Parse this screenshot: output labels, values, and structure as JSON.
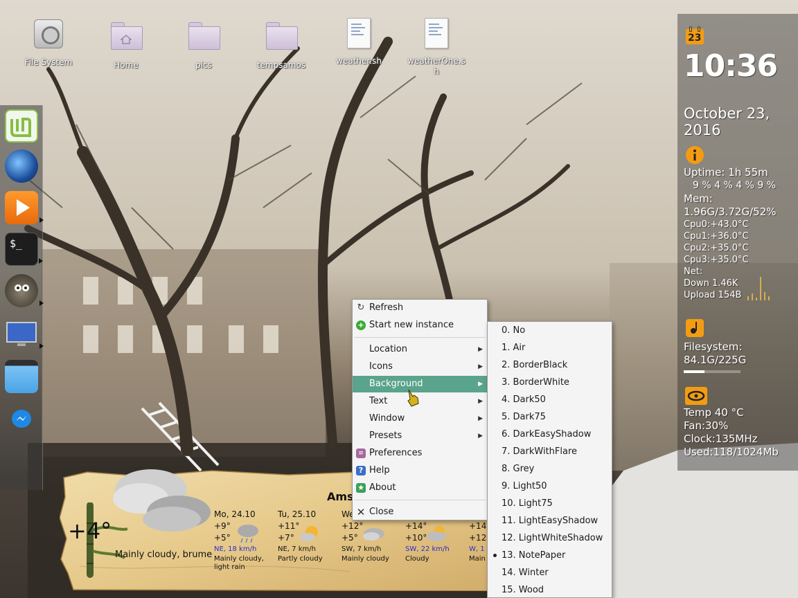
{
  "desktop": {
    "icons": [
      {
        "label": "File System",
        "icon": "drive-icon"
      },
      {
        "label": "Home",
        "icon": "home-folder-icon"
      },
      {
        "label": "pics",
        "icon": "folder-icon"
      },
      {
        "label": "tempsamos",
        "icon": "folder-icon"
      },
      {
        "label": "weather.sh",
        "icon": "script-file-icon"
      },
      {
        "label": "weatherOne.sh",
        "icon": "script-file-icon"
      }
    ]
  },
  "dock": {
    "items": [
      {
        "name": "linux-mint-menu",
        "icon": "mint-logo-icon"
      },
      {
        "name": "thunderbird",
        "icon": "thunderbird-icon"
      },
      {
        "name": "media-player",
        "icon": "play-icon"
      },
      {
        "name": "terminal",
        "icon": "terminal-icon",
        "text": "$_"
      },
      {
        "name": "gimp",
        "icon": "gimp-icon"
      },
      {
        "name": "display",
        "icon": "monitor-icon"
      },
      {
        "name": "files",
        "icon": "folder-blue-icon"
      },
      {
        "name": "messenger",
        "icon": "messenger-icon"
      }
    ]
  },
  "context_menu": {
    "items": [
      {
        "label": "Refresh",
        "icon": "refresh-icon",
        "submenu": false
      },
      {
        "label": "Start new instance",
        "icon": "plus-circle-icon",
        "submenu": false
      },
      {
        "label": "Location",
        "submenu": true
      },
      {
        "label": "Icons",
        "submenu": true
      },
      {
        "label": "Background",
        "submenu": true,
        "highlighted": true
      },
      {
        "label": "Text",
        "submenu": true
      },
      {
        "label": "Window",
        "submenu": true
      },
      {
        "label": "Presets",
        "submenu": true
      },
      {
        "label": "Preferences",
        "icon": "preferences-icon",
        "submenu": false
      },
      {
        "label": "Help",
        "icon": "help-icon",
        "submenu": false
      },
      {
        "label": "About",
        "icon": "about-icon",
        "submenu": false
      },
      {
        "label": "Close",
        "icon": "close-icon",
        "submenu": false
      }
    ],
    "submenu_arrow": "▶"
  },
  "background_submenu": {
    "selected": "13. NotePaper",
    "items": [
      "0. No",
      "1. Air",
      "2. BorderBlack",
      "3. BorderWhite",
      "4. Dark50",
      "5. Dark75",
      "6. DarkEasyShadow",
      "7. DarkWithFlare",
      "8. Grey",
      "9. Light50",
      "10. Light75",
      "11. LightEasyShadow",
      "12. LightWhiteShadow",
      "13. NotePaper",
      "14. Winter",
      "15. Wood"
    ]
  },
  "conky": {
    "calendar_day": "23",
    "time": "10:36",
    "date_line1": "October 23,",
    "date_line2": "2016",
    "uptime": "Uptime: 1h 55m",
    "cpu_usage": "9 % 4 % 4 % 9 %",
    "mem_label": "Mem:",
    "mem_value": "1.96G/3.72G/52%",
    "cpu_temps": [
      "Cpu0:+43.0°C",
      "Cpu1:+36.0°C",
      "Cpu2:+35.0°C",
      "Cpu3:+35.0°C"
    ],
    "net_label": "Net:",
    "down": "Down 1.46K",
    "upload": "Upload 154B",
    "filesystem_label": "Filesystem:",
    "filesystem_value": "84.1G/225G",
    "filesystem_usage": 0.37,
    "gpu_temp": "Temp 40 °C",
    "gpu_fan": "Fan:30%",
    "gpu_clock": "Clock:135MHz",
    "gpu_used": "Used:118/1024Mb",
    "accent": "#f39c12"
  },
  "weather": {
    "city": "Ams",
    "current_temp": "+4°",
    "current_condition": "Mainly cloudy, brume",
    "forecast": [
      {
        "day": "Mo, 24.10",
        "high": "+9°",
        "low": "+5°",
        "wind": "NE, 18 km/h",
        "condition": "Mainly cloudy,",
        "condition2": "light rain",
        "wind_blue": true
      },
      {
        "day": "Tu, 25.10",
        "high": "+11°",
        "low": "+7°",
        "wind": "NE, 7 km/h",
        "condition": "Partly cloudy",
        "condition2": "",
        "wind_blue": false
      },
      {
        "day": "We",
        "high": "+12°",
        "low": "+5°",
        "wind": "SW, 7 km/h",
        "condition": "Mainly cloudy",
        "condition2": "",
        "wind_blue": false
      },
      {
        "day": "",
        "high": "+14°",
        "low": "+10°",
        "wind": "SW, 22 km/h",
        "condition": "Cloudy",
        "condition2": "",
        "wind_blue": true
      },
      {
        "day": "",
        "high": "+14",
        "low": "+12",
        "wind": "W, 1",
        "condition": "Main",
        "condition2": "",
        "wind_blue": true
      }
    ]
  }
}
